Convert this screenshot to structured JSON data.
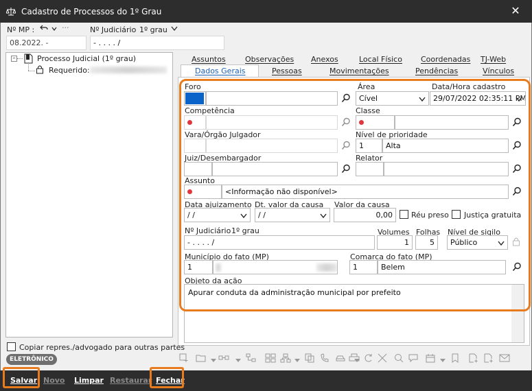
{
  "window": {
    "title": "Cadastro de Processos do 1º Grau",
    "close_glyph": "✕"
  },
  "top": {
    "mp_label": "Nº MP :",
    "mp_value": "08.2022.       -",
    "judiciario_label": "Nº Judiciário",
    "grau_label": "1º grau",
    "judiciario_value": "       -  .    .  . .     /"
  },
  "tree": {
    "root_label": "Processo Judicial (1º grau)",
    "child_label": "Requerido:"
  },
  "tabs": {
    "row1": [
      "Assuntos",
      "Observações",
      "Anexos",
      "Local Físico",
      "Coordenadas",
      "TJ-Web"
    ],
    "row2": [
      "Dados Gerais",
      "Pessoas",
      "Movimentações",
      "Pendências",
      "Vínculos"
    ],
    "active": "Dados Gerais"
  },
  "form": {
    "foro_label": "Foro",
    "area_label": "Área",
    "area_value": "Cível",
    "data_cadastro_label": "Data/Hora cadastro",
    "data_cadastro_value": "29/07/2022 02:35:11 PM",
    "competencia_label": "Competência",
    "classe_label": "Classe",
    "vara_label": "Vara/Órgão Julgador",
    "prioridade_label": "Nível de prioridade",
    "prioridade_code": "1",
    "prioridade_value": "Alta",
    "juiz_label": "Juiz/Desembargador",
    "relator_label": "Relator",
    "assunto_label": "Assunto",
    "assunto_value": "<Informação não disponível>",
    "data_ajuizamento_label": "Data ajuizamento",
    "data_ajuizamento_value": " / /",
    "dt_valor_label": "Dt. valor da causa",
    "dt_valor_value": " / /",
    "valor_label": "Valor da causa",
    "valor_value": "0,00",
    "reu_preso_label": "Réu preso",
    "justica_label": "Justiça gratuita",
    "judiciario_label": "Nº Judiciário",
    "grau_label": "1º grau",
    "judiciario_value": "       -  .    .  . .     /",
    "volumes_label": "Volumes",
    "volumes_value": "1",
    "folhas_label": "Folhas",
    "folhas_value": "5",
    "sigilo_label": "Nível de sigilo",
    "sigilo_value": "Público",
    "municipio_label": "Município do fato (MP)",
    "municipio_code": "1",
    "comarca_label": "Comarca do fato (MP)",
    "comarca_code": "1",
    "comarca_value": "Belem",
    "objeto_label": "Objeto da ação",
    "objeto_value": "Apurar conduta da administração municipal por prefeito"
  },
  "left_bottom": {
    "copiar_label": "Copiar repres./advogado para outras partes",
    "badge": "ELETRÔNICO"
  },
  "buttons": {
    "salvar": "Salvar",
    "novo": "Novo",
    "limpar": "Limpar",
    "restaurar": "Restaurar",
    "fechar": "Fechar"
  },
  "colors": {
    "accent": "#e87b1e",
    "titlebar": "#2d2d2d",
    "required_dot": "#e0363d",
    "foro_highlight": "#0a63c9",
    "active_tab_text": "#1a5fb4"
  }
}
